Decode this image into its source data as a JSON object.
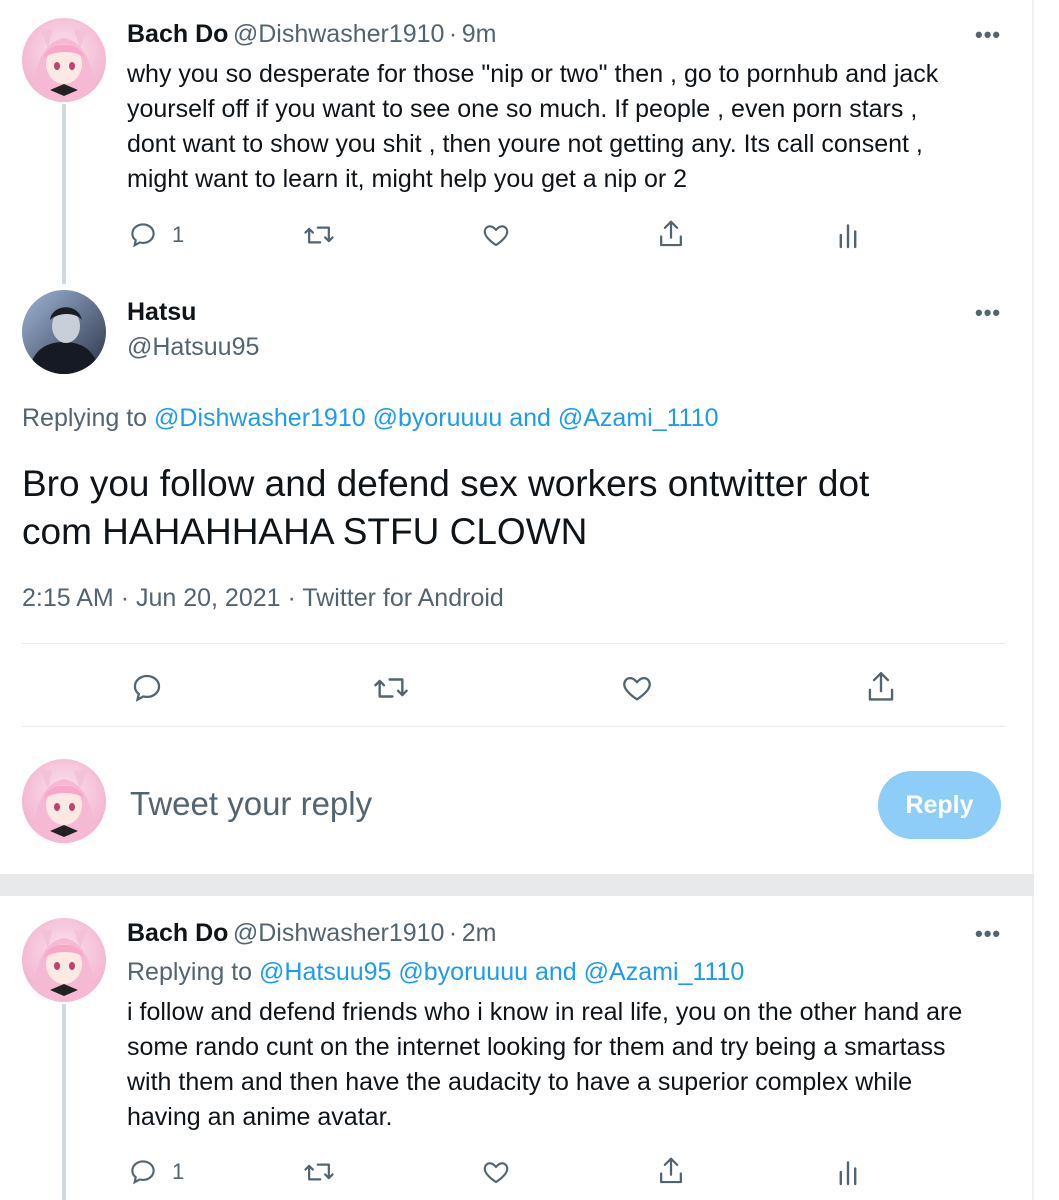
{
  "tweet1": {
    "name": "Bach Do",
    "handle": "@Dishwasher1910",
    "sep": "·",
    "time": "9m",
    "lines": [
      "why you so desperate for those \"nip or two\" then , go to pornhub and jack",
      "yourself off if you want to see one so much.  If people , even porn stars ,",
      "dont want to show you shit , then youre not getting any. Its call consent ,",
      "might want to learn it, might help you get a nip or 2"
    ],
    "reply_count": "1"
  },
  "tweet2": {
    "name": "Hatsu",
    "handle": "@Hatsuu95",
    "replying_label": "Replying to",
    "reply_to_1": "@Dishwasher1910",
    "reply_to_2": "@byoruuuu",
    "and_word": "and",
    "reply_to_3": "@Azami_1110",
    "lines": [
      "Bro you follow and defend sex workers ontwitter dot",
      "com HAHAHHAHA STFU CLOWN"
    ],
    "time": "2:15 AM",
    "date": "Jun 20, 2021",
    "source": "Twitter for Android",
    "sep": "·"
  },
  "composer": {
    "placeholder": "Tweet your reply",
    "reply_label": "Reply"
  },
  "tweet3": {
    "name": "Bach Do",
    "handle": "@Dishwasher1910",
    "sep": "·",
    "time": "2m",
    "replying_label": "Replying to",
    "reply_to_1": "@Hatsuu95",
    "reply_to_2": "@byoruuuu",
    "and_word": "and",
    "reply_to_3": "@Azami_1110",
    "lines": [
      "i follow and defend friends who i know in real life, you on the other hand are",
      "some rando cunt on the internet looking for them and try being a smartass",
      "with them and then have the audacity to have a superior complex while",
      "having an anime avatar."
    ],
    "reply_count": "1"
  },
  "icons": {
    "reply": "reply-icon",
    "retweet": "retweet-icon",
    "like": "like-icon",
    "share": "share-icon",
    "analytics": "analytics-icon",
    "more": "more-icon"
  },
  "colors": {
    "link": "#1d9bf0",
    "muted": "#536471",
    "reply_button": "#8ecdf8",
    "thread_line": "#cfd9de",
    "separator": "#e7e9ea"
  }
}
